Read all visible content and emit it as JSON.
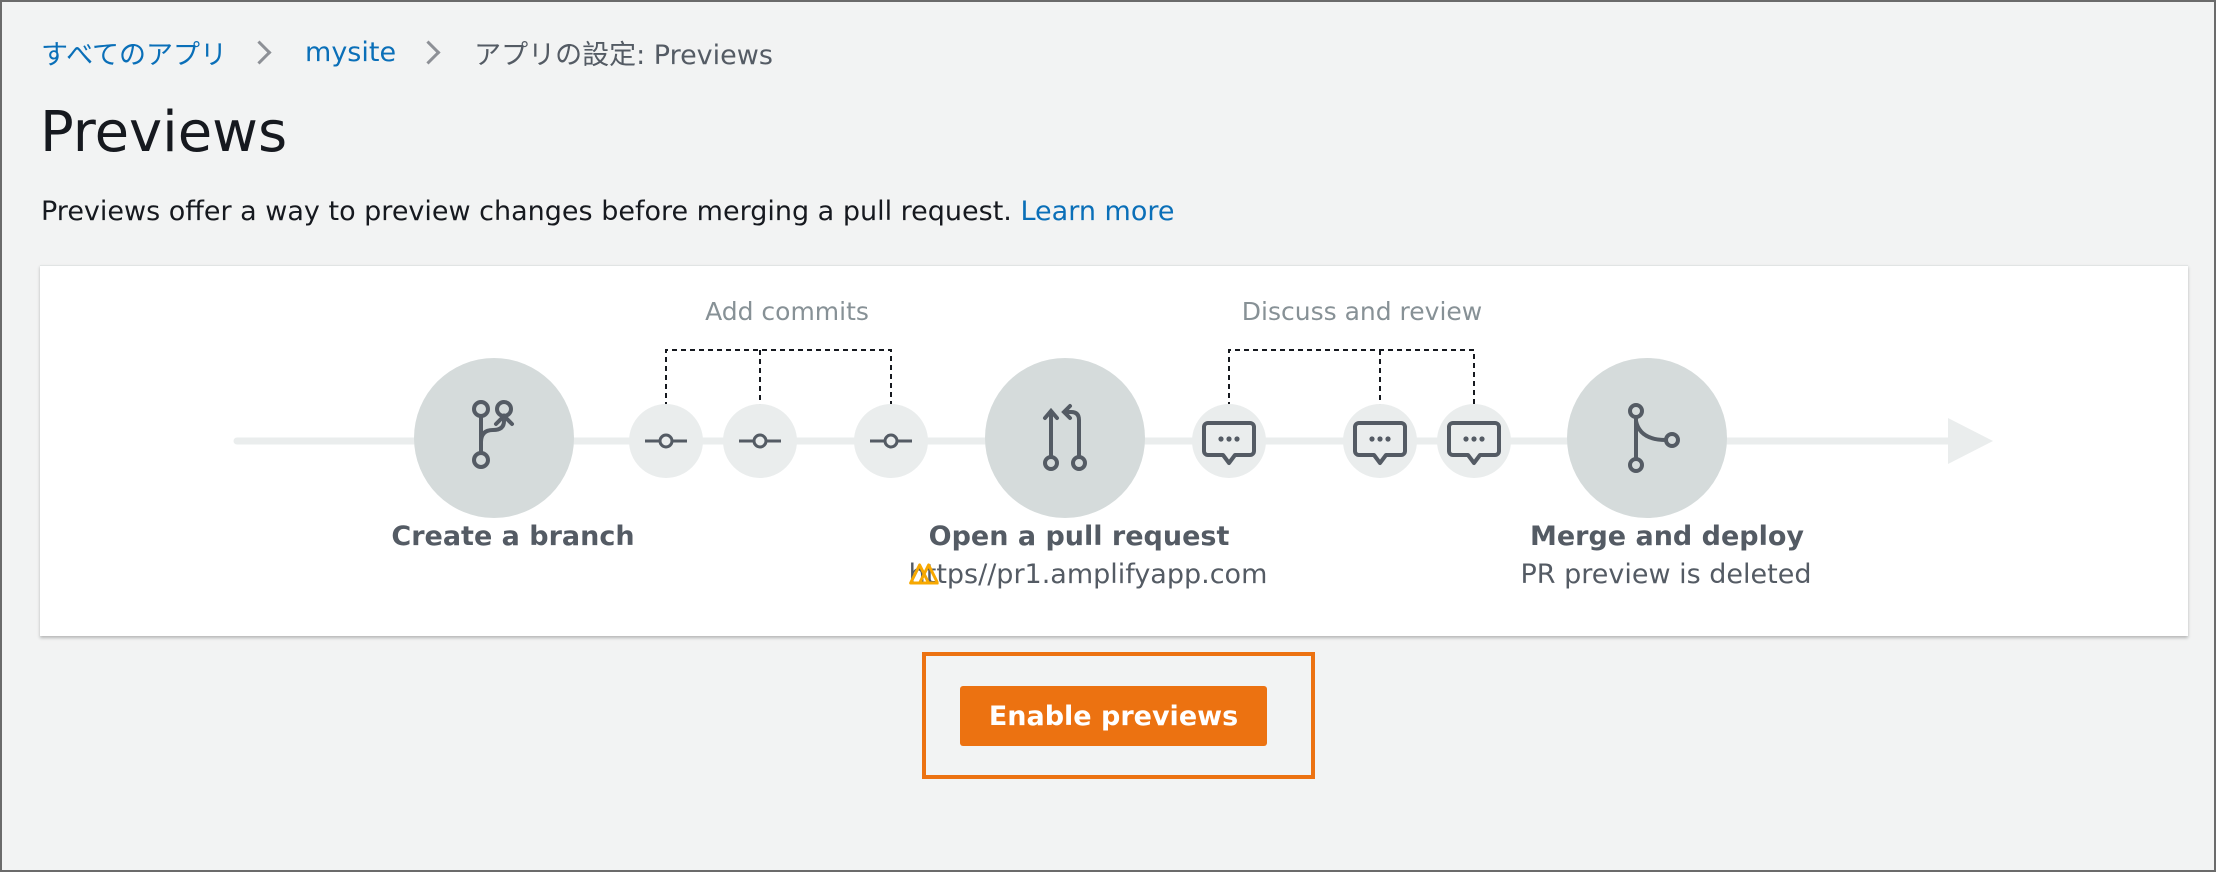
{
  "breadcrumb": {
    "items": [
      {
        "label": "すべてのアプリ"
      },
      {
        "label": "mysite"
      },
      {
        "label": "アプリの設定: Previews"
      }
    ]
  },
  "page": {
    "title": "Previews",
    "description": "Previews offer a way to preview changes before merging a pull request.",
    "learn_more": "Learn more"
  },
  "diagram": {
    "group_labels": {
      "commits": "Add commits",
      "review": "Discuss and review"
    },
    "steps": [
      {
        "label": "Create a branch",
        "icon": "branch-icon"
      },
      {
        "label": "Open a pull request",
        "sub": "https//pr1.amplifyapp.com",
        "sub_icon": "amplify-logo-icon",
        "icon": "pull-request-icon"
      },
      {
        "label": "Merge and deploy",
        "sub": "PR preview is deleted",
        "icon": "merge-icon"
      }
    ]
  },
  "actions": {
    "enable_previews": "Enable previews"
  },
  "colors": {
    "accent": "#ec7211",
    "link": "#0a6fb8",
    "circle": "#d5dbdb",
    "small_circle": "#eaeded"
  }
}
